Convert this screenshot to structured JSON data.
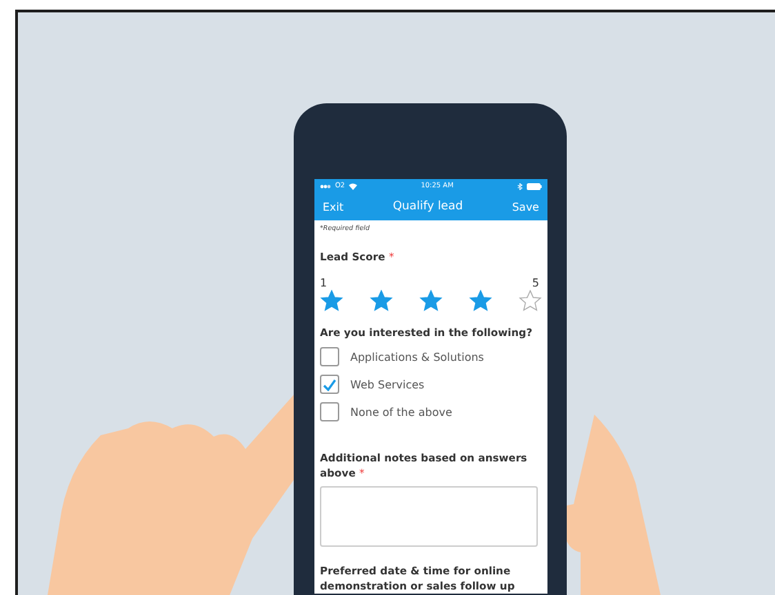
{
  "status_bar": {
    "carrier": "O2",
    "time": "10:25 AM"
  },
  "nav_bar": {
    "left_button": "Exit",
    "title": "Qualify lead",
    "right_button": "Save"
  },
  "form": {
    "required_note": "*Required field",
    "lead_score": {
      "label": "Lead Score",
      "required_mark": "*",
      "min_label": "1",
      "max_label": "5",
      "stars": 4
    },
    "interests": {
      "label": "Are you interested in the following?",
      "options": [
        {
          "label": "Applications & Solutions",
          "checked": false
        },
        {
          "label": "Web Services",
          "checked": true
        },
        {
          "label": "None of the above",
          "checked": false
        }
      ]
    },
    "notes": {
      "label": "Additional notes based on answers above",
      "required_mark": "*"
    },
    "preferred_date": {
      "label": "Preferred date & time for online demonstration or sales follow up"
    }
  }
}
